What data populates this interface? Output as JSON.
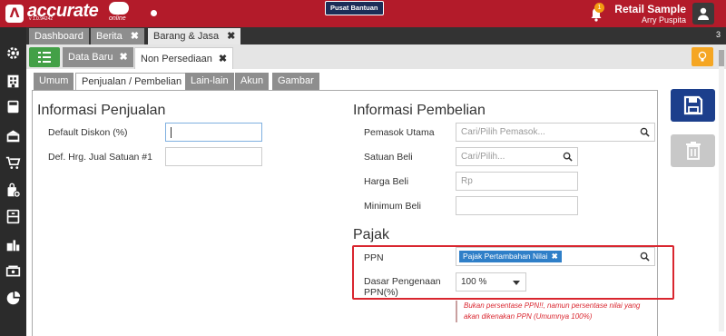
{
  "app": {
    "brand": "accurate",
    "brand_suffix": "online",
    "version": "v 1.0.94242",
    "help_label": "Pusat Bantuan",
    "notification_count": "1",
    "company_name": "Retail Sample",
    "user_name": "Arry Puspita",
    "accent_color": "#b31b2a"
  },
  "sidebar": {
    "icons": [
      "gear-icon",
      "building-icon",
      "calculator-icon",
      "bank-icon",
      "cart-icon",
      "bag-add-icon",
      "archive-box-icon",
      "factory-icon",
      "cash-icon",
      "pie-chart-icon"
    ]
  },
  "tabs": {
    "items": [
      {
        "label": "Dashboard"
      },
      {
        "label": "Berita"
      },
      {
        "label": "Barang & Jasa"
      }
    ],
    "count": "3"
  },
  "doc_tabs": {
    "new_label": "Data Baru",
    "active_label": "Non Persediaan",
    "modified_marker": "*"
  },
  "section_tabs": [
    "Umum",
    "Penjualan / Pembelian",
    "Lain-lain",
    "Akun",
    "Gambar"
  ],
  "penjualan": {
    "title": "Informasi Penjualan",
    "default_diskon_label": "Default Diskon (%)",
    "default_diskon_value": "",
    "harga_jual_label": "Def. Hrg. Jual Satuan #1",
    "harga_jual_value": ""
  },
  "pembelian": {
    "title": "Informasi Pembelian",
    "pemasok_label": "Pemasok Utama",
    "pemasok_placeholder": "Cari/Pilih Pemasok...",
    "satuan_label": "Satuan Beli",
    "satuan_placeholder": "Cari/Pilih...",
    "harga_label": "Harga Beli",
    "harga_placeholder": "Rp",
    "minimum_label": "Minimum Beli",
    "minimum_value": ""
  },
  "pajak": {
    "title": "Pajak",
    "ppn_label": "PPN",
    "ppn_tag": "Pajak Pertambahan Nilai",
    "dasar_label_1": "Dasar Pengenaan",
    "dasar_label_2": "PPN(%)",
    "dasar_value": "100 %",
    "note_line_1": "Bukan persentase PPN!!, namun persentase nilai yang",
    "note_line_2": "akan dikenakan PPN (Umumnya 100%)",
    "highlight_color": "#d9262f"
  }
}
